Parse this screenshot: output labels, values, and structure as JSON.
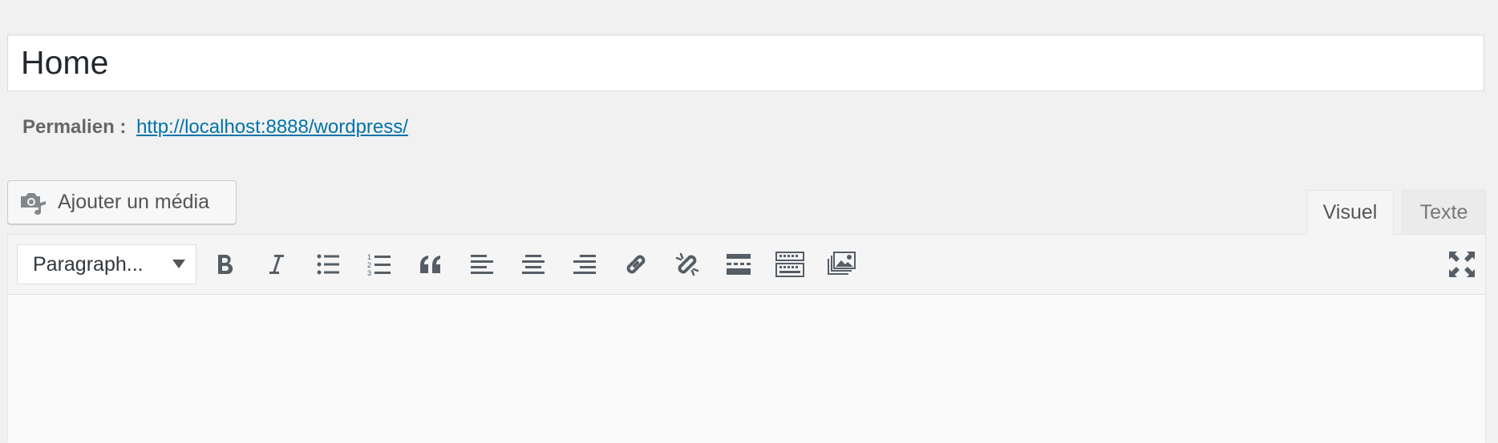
{
  "title_field": {
    "value": "Home"
  },
  "permalink": {
    "label": "Permalien :",
    "url": "http://localhost:8888/wordpress/"
  },
  "media_button": {
    "label": "Ajouter un média",
    "icon": "camera-music-icon"
  },
  "tabs": [
    {
      "label": "Visuel",
      "active": true
    },
    {
      "label": "Texte",
      "active": false
    }
  ],
  "toolbar": {
    "format_select": "Paragraph...",
    "buttons": [
      {
        "name": "bold",
        "icon": "bold-icon"
      },
      {
        "name": "italic",
        "icon": "italic-icon"
      },
      {
        "name": "bullet-list",
        "icon": "bullet-list-icon"
      },
      {
        "name": "numbered-list",
        "icon": "numbered-list-icon"
      },
      {
        "name": "blockquote",
        "icon": "quote-icon"
      },
      {
        "name": "align-left",
        "icon": "align-left-icon"
      },
      {
        "name": "align-center",
        "icon": "align-center-icon"
      },
      {
        "name": "align-right",
        "icon": "align-right-icon"
      },
      {
        "name": "insert-link",
        "icon": "link-icon"
      },
      {
        "name": "remove-link",
        "icon": "unlink-icon"
      },
      {
        "name": "read-more",
        "icon": "read-more-icon"
      },
      {
        "name": "toolbar-toggle",
        "icon": "keyboard-icon"
      },
      {
        "name": "gallery",
        "icon": "gallery-icon"
      },
      {
        "name": "fullscreen",
        "icon": "fullscreen-icon"
      }
    ]
  },
  "colors": {
    "background": "#f1f1f1",
    "link": "#0073aa",
    "icon": "#555d66",
    "border": "#dddddd"
  }
}
